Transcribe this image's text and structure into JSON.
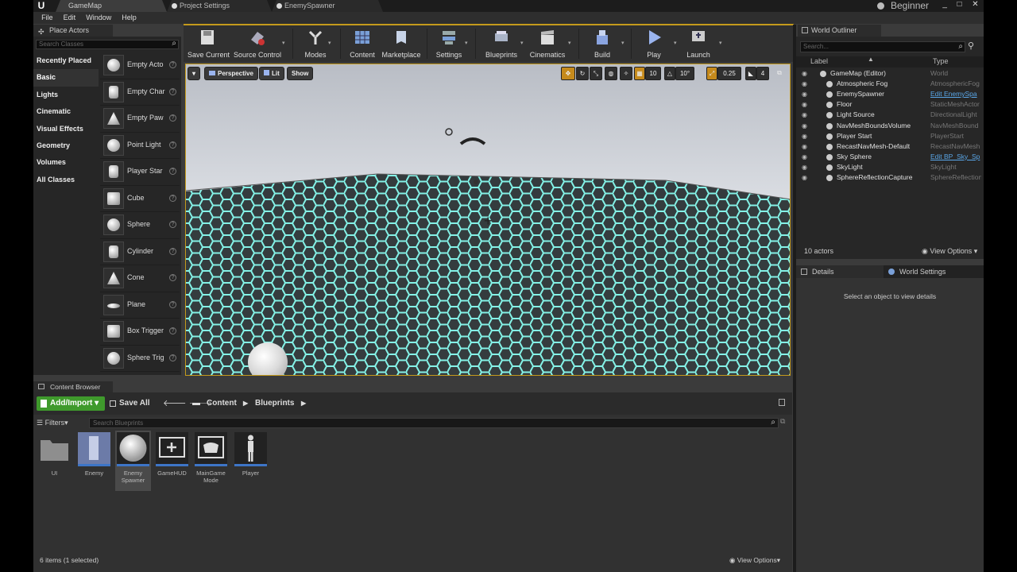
{
  "titlebar": {
    "tabs": [
      {
        "label": "GameMap"
      },
      {
        "label": "Project Settings"
      },
      {
        "label": "EnemySpawner"
      }
    ],
    "mode": "Beginner",
    "window_buttons": [
      "_",
      "□",
      "✕"
    ]
  },
  "menu": [
    "File",
    "Edit",
    "Window",
    "Help"
  ],
  "place_actors": {
    "tab_label": "Place Actors",
    "search_placeholder": "Search Classes",
    "categories": [
      "Recently Placed",
      "Basic",
      "Lights",
      "Cinematic",
      "Visual Effects",
      "Geometry",
      "Volumes",
      "All Classes"
    ],
    "selected_category": "Basic",
    "items": [
      {
        "label": "Empty Acto",
        "icon": "sphere-icon"
      },
      {
        "label": "Empty Char",
        "icon": "character-icon"
      },
      {
        "label": "Empty Paw",
        "icon": "pawn-icon"
      },
      {
        "label": "Point Light",
        "icon": "point-light-icon"
      },
      {
        "label": "Player Star",
        "icon": "player-start-icon"
      },
      {
        "label": "Cube",
        "icon": "cube-icon"
      },
      {
        "label": "Sphere",
        "icon": "sphere-icon"
      },
      {
        "label": "Cylinder",
        "icon": "cylinder-icon"
      },
      {
        "label": "Cone",
        "icon": "cone-icon"
      },
      {
        "label": "Plane",
        "icon": "plane-icon"
      },
      {
        "label": "Box Trigger",
        "icon": "box-trigger-icon"
      },
      {
        "label": "Sphere Trig",
        "icon": "sphere-trigger-icon"
      }
    ]
  },
  "toolbar": {
    "buttons": [
      {
        "label": "Save Current",
        "icon": "save-icon"
      },
      {
        "label": "Source Control",
        "icon": "source-control-icon"
      },
      {
        "label": "Modes",
        "icon": "modes-icon"
      },
      {
        "label": "Content",
        "icon": "content-icon"
      },
      {
        "label": "Marketplace",
        "icon": "marketplace-icon"
      },
      {
        "label": "Settings",
        "icon": "settings-icon"
      },
      {
        "label": "Blueprints",
        "icon": "blueprints-icon"
      },
      {
        "label": "Cinematics",
        "icon": "cinematics-icon"
      },
      {
        "label": "Build",
        "icon": "build-icon"
      },
      {
        "label": "Play",
        "icon": "play-icon"
      },
      {
        "label": "Launch",
        "icon": "launch-icon"
      }
    ]
  },
  "viewport": {
    "dropdown": "▾",
    "perspective": "Perspective",
    "lit": "Lit",
    "show": "Show",
    "grid_snap": "10",
    "rotation_snap": "10°",
    "scale_snap": "0.25",
    "camera_speed": "4",
    "accent": "#c49a1c"
  },
  "world_outliner": {
    "tab_label": "World Outliner",
    "search_placeholder": "Search...",
    "col_label": "Label",
    "col_type": "Type",
    "rows": [
      {
        "label": "GameMap (Editor)",
        "type": "World",
        "link": false,
        "indent": 0
      },
      {
        "label": "Atmospheric Fog",
        "type": "AtmosphericFog",
        "link": false,
        "indent": 1
      },
      {
        "label": "EnemySpawner",
        "type": "Edit EnemySpa",
        "link": true,
        "indent": 1
      },
      {
        "label": "Floor",
        "type": "StaticMeshActor",
        "link": false,
        "indent": 1
      },
      {
        "label": "Light Source",
        "type": "DirectionalLight",
        "link": false,
        "indent": 1
      },
      {
        "label": "NavMeshBoundsVolume",
        "type": "NavMeshBound",
        "link": false,
        "indent": 1
      },
      {
        "label": "Player Start",
        "type": "PlayerStart",
        "link": false,
        "indent": 1
      },
      {
        "label": "RecastNavMesh-Default",
        "type": "RecastNavMesh",
        "link": false,
        "indent": 1
      },
      {
        "label": "Sky Sphere",
        "type": "Edit BP_Sky_Sp",
        "link": true,
        "indent": 1
      },
      {
        "label": "SkyLight",
        "type": "SkyLight",
        "link": false,
        "indent": 1
      },
      {
        "label": "SphereReflectionCapture",
        "type": "SphereReflection",
        "link": false,
        "indent": 1
      }
    ],
    "actor_count": "10 actors",
    "view_options": "View Options"
  },
  "details": {
    "tab_details": "Details",
    "tab_world_settings": "World Settings",
    "message": "Select an object to view details"
  },
  "content_browser": {
    "tab_label": "Content Browser",
    "add_import": "Add/Import",
    "save_all": "Save All",
    "breadcrumb": [
      "Content",
      "Blueprints"
    ],
    "filters": "Filters",
    "search_placeholder": "Search Blueprints",
    "assets": [
      {
        "name": "UI",
        "type": "folder"
      },
      {
        "name": "Enemy",
        "type": "blueprint"
      },
      {
        "name": "Enemy Spawner",
        "type": "blueprint",
        "selected": true
      },
      {
        "name": "GameHUD",
        "type": "blueprint"
      },
      {
        "name": "MainGame Mode",
        "type": "blueprint"
      },
      {
        "name": "Player",
        "type": "blueprint"
      }
    ],
    "status": "6 items (1 selected)",
    "view_options": "View Options"
  }
}
